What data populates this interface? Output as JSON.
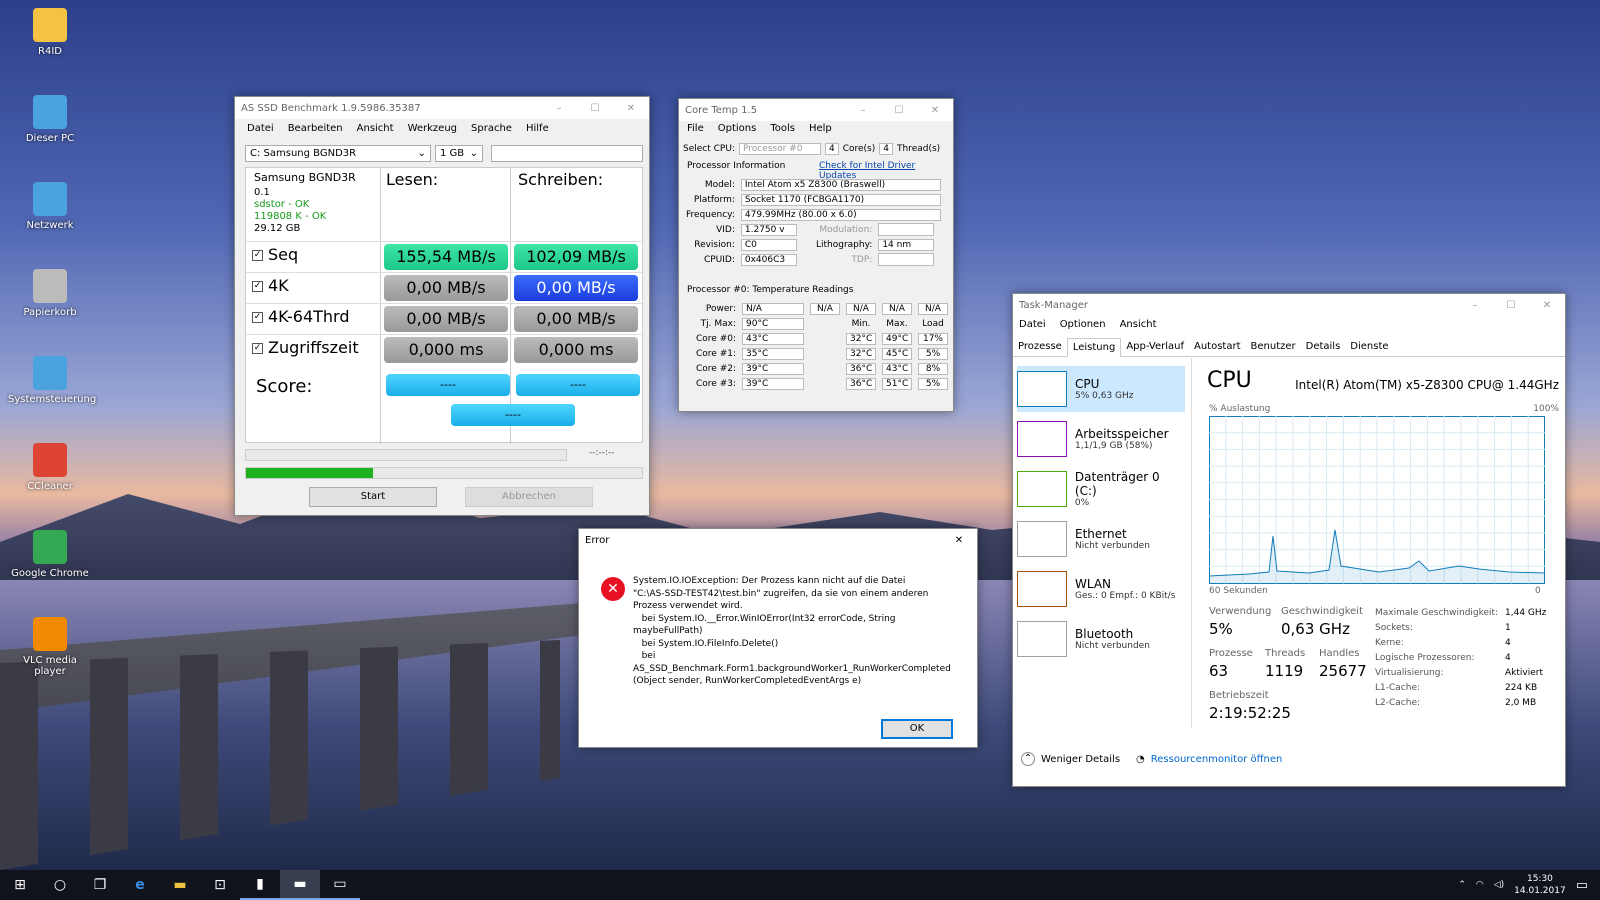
{
  "desktop": {
    "icons": [
      "R4ID",
      "Dieser PC",
      "Netzwerk",
      "Papierkorb",
      "Systemsteuerung",
      "CCleaner",
      "Google Chrome",
      "VLC media player"
    ]
  },
  "asssd": {
    "title": "AS SSD Benchmark 1.9.5986.35387",
    "menu": [
      "Datei",
      "Bearbeiten",
      "Ansicht",
      "Werkzeug",
      "Sprache",
      "Hilfe"
    ],
    "drive": "C: Samsung BGND3R",
    "size": "1 GB",
    "info": [
      "Samsung BGND3R",
      "0.1",
      "sdstor - OK",
      "119808 K - OK",
      "29.12 GB"
    ],
    "read_h": "Lesen:",
    "write_h": "Schreiben:",
    "rows": [
      {
        "label": "Seq",
        "read": "155,54 MB/s",
        "write": "102,09 MB/s"
      },
      {
        "label": "4K",
        "read": "0,00 MB/s",
        "write": "0,00 MB/s"
      },
      {
        "label": "4K-64Thrd",
        "read": "0,00 MB/s",
        "write": "0,00 MB/s"
      },
      {
        "label": "Zugriffszeit",
        "read": "0,000 ms",
        "write": "0,000 ms"
      }
    ],
    "score": "Score:",
    "dash": "----",
    "time": "--:--:--",
    "progress": 0.32,
    "start": "Start",
    "abort": "Abbrechen"
  },
  "coretemp": {
    "title": "Core Temp 1.5",
    "menu": [
      "File",
      "Options",
      "Tools",
      "Help"
    ],
    "select_cpu": "Select CPU:",
    "proc": "Processor #0",
    "cores": "4",
    "cores_l": "Core(s)",
    "threads": "4",
    "threads_l": "Thread(s)",
    "pinfo": "Processor Information",
    "link": "Check for Intel Driver Updates",
    "model_l": "Model:",
    "model": "Intel Atom x5 Z8300 (Braswell)",
    "platform_l": "Platform:",
    "platform": "Socket 1170 (FCBGA1170)",
    "freq_l": "Frequency:",
    "freq": "479.99MHz (80.00 x 6.0)",
    "vid_l": "VID:",
    "vid": "1.2750 v",
    "mod_l": "Modulation:",
    "rev_l": "Revision:",
    "rev": "C0",
    "lith_l": "Lithography:",
    "lith": "14 nm",
    "cpuid_l": "CPUID:",
    "cpuid": "0x406C3",
    "tdp_l": "TDP:",
    "temps": "Processor #0: Temperature Readings",
    "power_l": "Power:",
    "na": "N/A",
    "tjmax_l": "Tj. Max:",
    "tjmax": "90°C",
    "min": "Min.",
    "max": "Max.",
    "load": "Load",
    "cores_t": [
      {
        "n": "Core #0:",
        "t": "43°C",
        "mi": "32°C",
        "ma": "49°C",
        "l": "17%"
      },
      {
        "n": "Core #1:",
        "t": "35°C",
        "mi": "32°C",
        "ma": "45°C",
        "l": "5%"
      },
      {
        "n": "Core #2:",
        "t": "39°C",
        "mi": "36°C",
        "ma": "43°C",
        "l": "8%"
      },
      {
        "n": "Core #3:",
        "t": "39°C",
        "mi": "36°C",
        "ma": "51°C",
        "l": "5%"
      }
    ]
  },
  "error": {
    "title": "Error",
    "msg": [
      "System.IO.IOException: Der Prozess kann nicht auf die Datei",
      "\"C:\\AS-SSD-TEST42\\test.bin\" zugreifen, da sie von einem anderen",
      "Prozess verwendet wird.",
      "   bei System.IO.__Error.WinIOError(Int32 errorCode, String",
      "maybeFullPath)",
      "   bei System.IO.FileInfo.Delete()",
      "   bei",
      "AS_SSD_Benchmark.Form1.backgroundWorker1_RunWorkerCompleted",
      "(Object sender, RunWorkerCompletedEventArgs e)"
    ],
    "ok": "OK"
  },
  "tm": {
    "title": "Task-Manager",
    "menu": [
      "Datei",
      "Optionen",
      "Ansicht"
    ],
    "tabs": [
      "Prozesse",
      "Leistung",
      "App-Verlauf",
      "Autostart",
      "Benutzer",
      "Details",
      "Dienste"
    ],
    "side": [
      {
        "n": "CPU",
        "s": "5% 0,63 GHz"
      },
      {
        "n": "Arbeitsspeicher",
        "s": "1,1/1,9 GB (58%)"
      },
      {
        "n": "Datenträger 0 (C:)",
        "s": "0%"
      },
      {
        "n": "Ethernet",
        "s": "Nicht verbunden"
      },
      {
        "n": "WLAN",
        "s": "Ges.: 0 Empf.: 0 KBit/s"
      },
      {
        "n": "Bluetooth",
        "s": "Nicht verbunden"
      }
    ],
    "cpu_h": "CPU",
    "cpu_name": "Intel(R) Atom(TM) x5-Z8300 CPU@ 1.44GHz",
    "util": "% Auslastung",
    "pct100": "100%",
    "sec": "60 Sekunden",
    "zero": "0",
    "verw_l": "Verwendung",
    "verw": "5%",
    "gesch_l": "Geschwindigkeit",
    "gesch": "0,63 GHz",
    "proz_l": "Prozesse",
    "proz": "63",
    "thr_l": "Threads",
    "thr": "1119",
    "hdl_l": "Handles",
    "hdl": "25677",
    "bz_l": "Betriebszeit",
    "bz": "2:19:52:25",
    "specs": [
      {
        "k": "Maximale Geschwindigkeit:",
        "v": "1,44 GHz"
      },
      {
        "k": "Sockets:",
        "v": "1"
      },
      {
        "k": "Kerne:",
        "v": "4"
      },
      {
        "k": "Logische Prozessoren:",
        "v": "4"
      },
      {
        "k": "Virtualisierung:",
        "v": "Aktiviert"
      },
      {
        "k": "L1-Cache:",
        "v": "224 KB"
      },
      {
        "k": "L2-Cache:",
        "v": "2,0 MB"
      }
    ],
    "less": "Weniger Details",
    "resmon": "Ressourcenmonitor öffnen"
  },
  "taskbar": {
    "time": "15:30",
    "date": "14.01.2017"
  }
}
